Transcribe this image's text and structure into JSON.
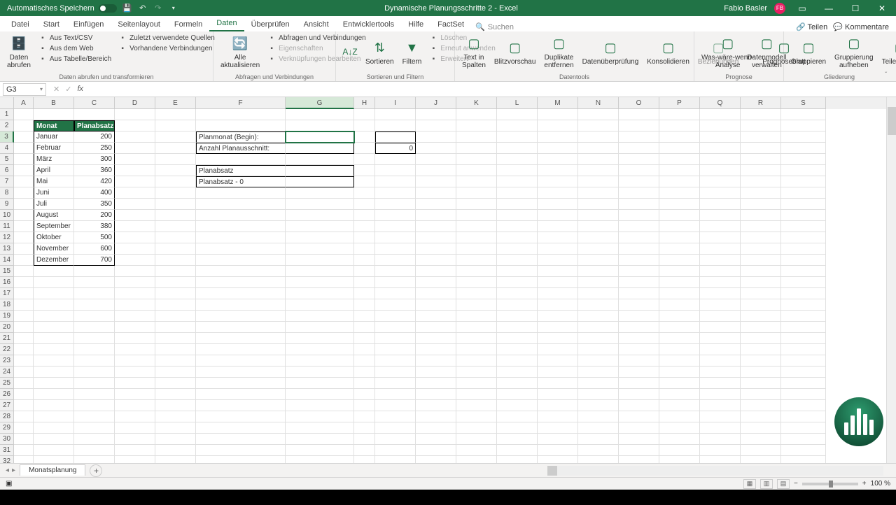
{
  "titlebar": {
    "autosave": "Automatisches Speichern",
    "doc_title": "Dynamische Planungsschritte 2  -  Excel",
    "user": "Fabio Basler",
    "user_initials": "FB"
  },
  "tabs": [
    "Datei",
    "Start",
    "Einfügen",
    "Seitenlayout",
    "Formeln",
    "Daten",
    "Überprüfen",
    "Ansicht",
    "Entwicklertools",
    "Hilfe",
    "FactSet"
  ],
  "active_tab": "Daten",
  "search_placeholder": "Suchen",
  "ribbon_right": {
    "share": "Teilen",
    "comments": "Kommentare"
  },
  "ribbon": {
    "get": {
      "big": "Daten\nabrufen",
      "items": [
        "Aus Text/CSV",
        "Aus dem Web",
        "Aus Tabelle/Bereich",
        "Zuletzt verwendete Quellen",
        "Vorhandene Verbindungen"
      ],
      "label": "Daten abrufen und transformieren"
    },
    "refresh": {
      "big": "Alle\naktualisieren",
      "items": [
        "Abfragen und Verbindungen",
        "Eigenschaften",
        "Verknüpfungen bearbeiten"
      ],
      "label": "Abfragen und Verbindungen"
    },
    "sort": {
      "sort_btn": "Sortieren",
      "filter_btn": "Filtern",
      "items": [
        "Löschen",
        "Erneut anwenden",
        "Erweitert"
      ],
      "label": "Sortieren und Filtern"
    },
    "tools": {
      "btns": [
        "Text in\nSpalten",
        "Blitzvorschau",
        "Duplikate\nentfernen",
        "Datenüberprüfung",
        "Konsolidieren",
        "Beziehungen",
        "Datenmodell\nverwalten"
      ],
      "label": "Datentools"
    },
    "forecast": {
      "btns": [
        "Was-wäre-wenn-\nAnalyse",
        "Prognoseblatt"
      ],
      "label": "Prognose"
    },
    "outline": {
      "btns": [
        "Gruppieren",
        "Gruppierung\naufheben",
        "Teilergebnis"
      ],
      "label": "Gliederung"
    }
  },
  "namebox": "G3",
  "columns": [
    "A",
    "B",
    "C",
    "D",
    "E",
    "F",
    "G",
    "H",
    "I",
    "J",
    "K",
    "L",
    "M",
    "N",
    "O",
    "P",
    "Q",
    "R",
    "S"
  ],
  "col_widths": [
    "wA",
    "wB",
    "wC",
    "wD",
    "wE",
    "wF",
    "wG",
    "wH",
    "wI",
    "wJ",
    "wK",
    "wL",
    "wM",
    "wN",
    "wO",
    "wP",
    "wQ",
    "wR",
    "wS"
  ],
  "selected_col": "G",
  "selected_row": 3,
  "row_count": 32,
  "table_header": {
    "b": "Monat",
    "c": "Planabsatz"
  },
  "months": [
    {
      "m": "Januar",
      "v": 200
    },
    {
      "m": "Februar",
      "v": 250
    },
    {
      "m": "März",
      "v": 300
    },
    {
      "m": "April",
      "v": 360
    },
    {
      "m": "Mai",
      "v": 420
    },
    {
      "m": "Juni",
      "v": 400
    },
    {
      "m": "Juli",
      "v": 350
    },
    {
      "m": "August",
      "v": 200
    },
    {
      "m": "September",
      "v": 380
    },
    {
      "m": "Oktober",
      "v": 500
    },
    {
      "m": "November",
      "v": 600
    },
    {
      "m": "Dezember",
      "v": 700
    }
  ],
  "plan_labels": {
    "f3": "Planmonat (Begin):",
    "f4": "Anzahl Planausschnitt:",
    "f6": "Planabsatz",
    "f7": "Planabsatz   - 0",
    "i4": "0"
  },
  "sheet_tab": "Monatsplanung",
  "zoom": "100 %"
}
